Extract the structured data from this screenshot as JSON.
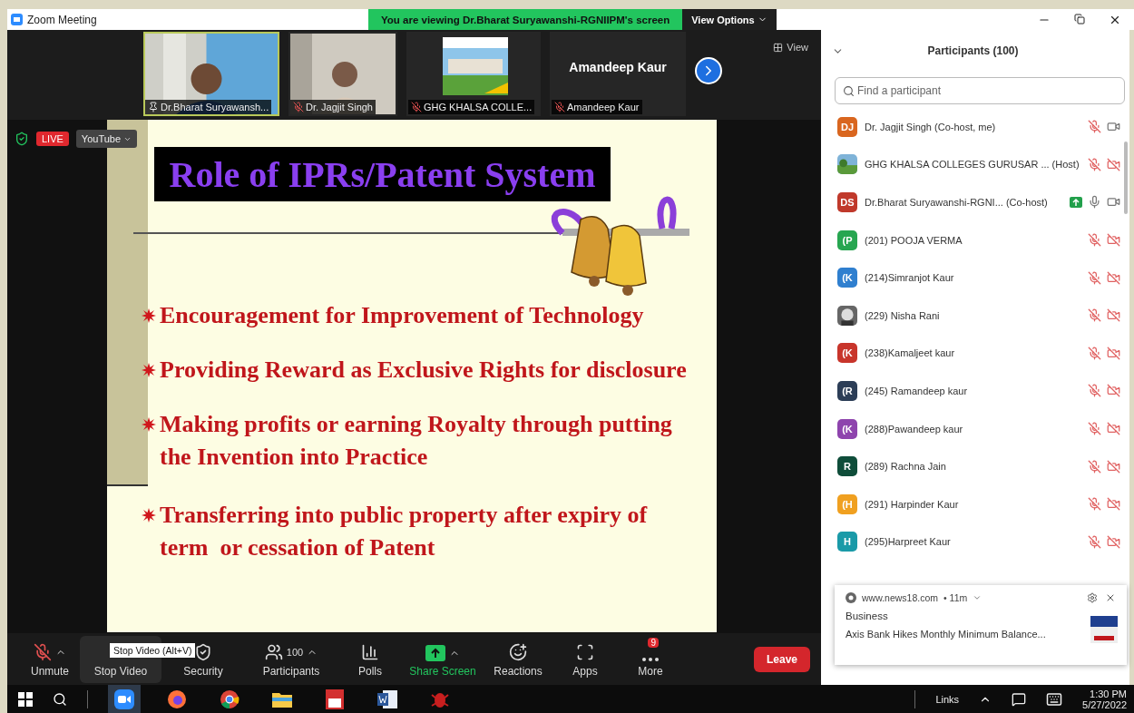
{
  "window": {
    "title": "Zoom Meeting"
  },
  "share_banner": {
    "text": "You are viewing Dr.Bharat Suryawanshi-RGNIIPM's screen",
    "button": "View Options"
  },
  "thumbnails": [
    {
      "name": "Dr.Bharat Suryawansh...",
      "kind": "video",
      "muted": false,
      "selected": true
    },
    {
      "name": "Dr. Jagjit Singh",
      "kind": "video",
      "muted": true,
      "selected": false
    },
    {
      "name": "GHG KHALSA COLLE...",
      "muted": true,
      "selected": false
    },
    {
      "name": "Amandeep Kaur",
      "kind": "name",
      "display": "Amandeep Kaur",
      "muted": true,
      "selected": false
    }
  ],
  "view_button": "View",
  "live": {
    "badge": "LIVE",
    "platform": "YouTube"
  },
  "slide": {
    "title": "Role of IPRs/Patent System",
    "bullets": [
      "Encouragement for Improvement of Technology",
      "Providing Reward as Exclusive Rights for disclosure",
      "Making profits or earning Royalty through putting the Invention into Practice",
      "Transferring into public property after expiry of term  or cessation of Patent"
    ]
  },
  "toolbar": {
    "items": [
      {
        "kind": "mic",
        "label": "Unmute",
        "caret": true
      },
      {
        "kind": "video",
        "label": "Stop Video",
        "caret": false,
        "tooltip": "Stop Video (Alt+V)"
      },
      {
        "kind": "security",
        "label": "Security",
        "caret": false
      },
      {
        "kind": "participants",
        "label": "Participants",
        "count": "100",
        "caret": true
      },
      {
        "kind": "polls",
        "label": "Polls",
        "caret": false
      },
      {
        "kind": "share",
        "label": "Share Screen",
        "caret": true
      },
      {
        "kind": "reactions",
        "label": "Reactions",
        "caret": false
      },
      {
        "kind": "apps",
        "label": "Apps",
        "caret": false
      },
      {
        "kind": "more",
        "label": "More",
        "badge": "9",
        "caret": false
      }
    ],
    "leave": "Leave"
  },
  "participants_panel": {
    "title": "Participants (100)",
    "search_placeholder": "Find a participant",
    "rows": [
      {
        "kind": "initials",
        "initials": "DJ",
        "color": "#d9661f",
        "name": "Dr. Jagjit Singh (Co-host, me)",
        "sharing": false,
        "mic_muted": true,
        "video_off": false
      },
      {
        "name": "GHG KHALSA COLLEGES GURUSAR ... (Host)",
        "sharing": false,
        "mic_muted": true,
        "video_off": true
      },
      {
        "kind": "initials",
        "initials": "DS",
        "color": "#c0392b",
        "name": "Dr.Bharat Suryawanshi-RGNI... (Co-host)",
        "sharing": true,
        "mic_muted": false,
        "video_off": false
      },
      {
        "kind": "initials",
        "initials": "(P",
        "color": "#27a650",
        "name": "(201) POOJA VERMA",
        "sharing": false,
        "mic_muted": true,
        "video_off": true
      },
      {
        "kind": "initials",
        "initials": "(K",
        "color": "#2f7fcf",
        "name": "(214)Simranjot Kaur",
        "sharing": false,
        "mic_muted": true,
        "video_off": true
      },
      {
        "name": "(229) Nisha Rani",
        "sharing": false,
        "mic_muted": true,
        "video_off": true
      },
      {
        "kind": "initials",
        "initials": "(K",
        "color": "#c8352b",
        "name": "(238)Kamaljeet kaur",
        "sharing": false,
        "mic_muted": true,
        "video_off": true
      },
      {
        "kind": "initials",
        "initials": "(R",
        "color": "#2c3e57",
        "name": "(245) Ramandeep kaur",
        "sharing": false,
        "mic_muted": true,
        "video_off": true
      },
      {
        "kind": "initials",
        "initials": "(K",
        "color": "#8e44ad",
        "name": "(288)Pawandeep kaur",
        "sharing": false,
        "mic_muted": true,
        "video_off": true
      },
      {
        "kind": "initials",
        "initials": "R",
        "color": "#0f4d3a",
        "name": "(289) Rachna Jain",
        "sharing": false,
        "mic_muted": true,
        "video_off": true
      },
      {
        "kind": "initials",
        "initials": "(H",
        "color": "#f0a020",
        "name": "(291) Harpinder Kaur",
        "sharing": false,
        "mic_muted": true,
        "video_off": true
      },
      {
        "kind": "initials",
        "initials": "H",
        "color": "#1a9aa8",
        "name": "(295)Harpreet Kaur",
        "sharing": false,
        "mic_muted": true,
        "video_off": true
      }
    ]
  },
  "notification": {
    "source": "www.news18.com",
    "age": "• 11m",
    "category": "Business",
    "headline": "Axis Bank Hikes Monthly Minimum Balance..."
  },
  "taskbar": {
    "apps": [
      {
        "kind": "zoom",
        "selected": true
      },
      {
        "kind": "firefox",
        "selected": false
      },
      {
        "kind": "chrome",
        "selected": false
      },
      {
        "kind": "folder",
        "selected": false
      },
      {
        "kind": "pdf",
        "selected": false
      },
      {
        "kind": "word",
        "selected": false
      },
      {
        "kind": "bug",
        "selected": false
      }
    ],
    "links": "Links",
    "time": "1:30 PM",
    "date": "5/27/2022"
  }
}
